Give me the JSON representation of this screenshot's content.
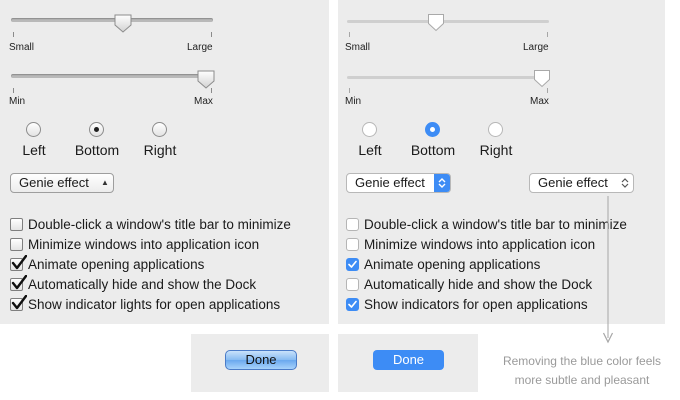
{
  "old_panel": {
    "size_slider": {
      "min_label": "Small",
      "max_label": "Large",
      "value": 0.54
    },
    "mag_slider": {
      "min_label": "Min",
      "max_label": "Max",
      "value": 1.0
    },
    "position": {
      "options": [
        "Left",
        "Bottom",
        "Right"
      ],
      "selected": "Bottom"
    },
    "minimize_effect": {
      "selected": "Genie effect"
    },
    "checkboxes": [
      {
        "label": "Double-click a window's title bar to minimize",
        "checked": false
      },
      {
        "label": "Minimize windows into application icon",
        "checked": false
      },
      {
        "label": "Animate opening applications",
        "checked": true
      },
      {
        "label": "Automatically hide and show the Dock",
        "checked": true
      },
      {
        "label": "Show indicator lights for open applications",
        "checked": true
      }
    ],
    "done_label": "Done"
  },
  "new_panel": {
    "size_slider": {
      "min_label": "Small",
      "max_label": "Large",
      "value": 0.44
    },
    "mag_slider": {
      "min_label": "Min",
      "max_label": "Max",
      "value": 1.0
    },
    "position": {
      "options": [
        "Left",
        "Bottom",
        "Right"
      ],
      "selected": "Bottom"
    },
    "minimize_effect_blue": {
      "selected": "Genie effect"
    },
    "minimize_effect_plain": {
      "selected": "Genie effect"
    },
    "checkboxes": [
      {
        "label": "Double-click a window's title bar to minimize",
        "checked": false
      },
      {
        "label": "Minimize windows into application icon",
        "checked": false
      },
      {
        "label": "Animate opening applications",
        "checked": true
      },
      {
        "label": "Automatically hide and show the Dock",
        "checked": false
      },
      {
        "label": "Show indicators for open applications",
        "checked": true
      }
    ],
    "done_label": "Done"
  },
  "annotation": {
    "line1": "Removing the blue color feels",
    "line2": "more subtle and pleasant"
  },
  "colors": {
    "accent": "#3d8cf5",
    "panel": "#ececec",
    "annotation": "#9a9a9a"
  }
}
